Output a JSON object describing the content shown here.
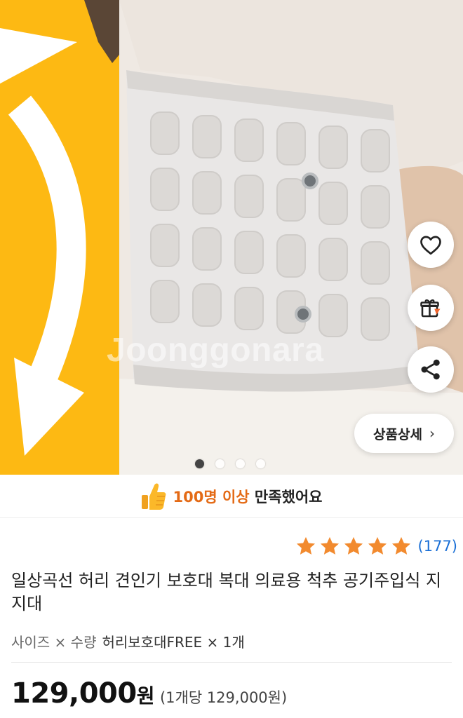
{
  "gallery": {
    "watermark": "Joonggonara",
    "dots_total": 4,
    "active_index": 0,
    "detail_button": "상품상세",
    "chevron": "›",
    "accent": "#FDB913"
  },
  "actions": {
    "like_icon": "heart-icon",
    "gift_icon": "gift-icon",
    "share_icon": "share-icon"
  },
  "satisfaction": {
    "highlight": "100명 이상",
    "rest": " 만족했어요",
    "icon": "thumbs-up-icon",
    "highlight_color": "#E46A15"
  },
  "rating": {
    "stars": 5,
    "star_color": "#F28A2E",
    "count": "(177)"
  },
  "product": {
    "title": "일상곡선 허리 견인기 보호대 복대 의료용 척추 공기주입식 지지대",
    "options_label": "사이즈 × 수량",
    "options_value": "허리보호대FREE × 1개",
    "price": "129,000",
    "price_unit": "원",
    "unit_price": "(1개당 129,000원)"
  }
}
